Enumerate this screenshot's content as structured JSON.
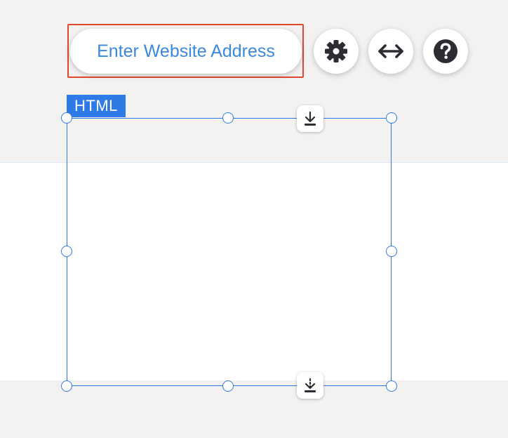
{
  "toolbar": {
    "address_placeholder": "Enter Website Address",
    "settings_icon": "gear-icon",
    "stretch_icon": "horizontal-arrows-icon",
    "help_icon": "question-mark-icon"
  },
  "component": {
    "tag_label": "HTML",
    "accent_color": "#2f7be6",
    "top_anchor_icon": "dock-top-icon",
    "bottom_anchor_icon": "dock-bottom-icon"
  },
  "colors": {
    "highlight": "#e0472e",
    "link_text": "#3b88df",
    "icon_dark": "#2b2d33"
  }
}
